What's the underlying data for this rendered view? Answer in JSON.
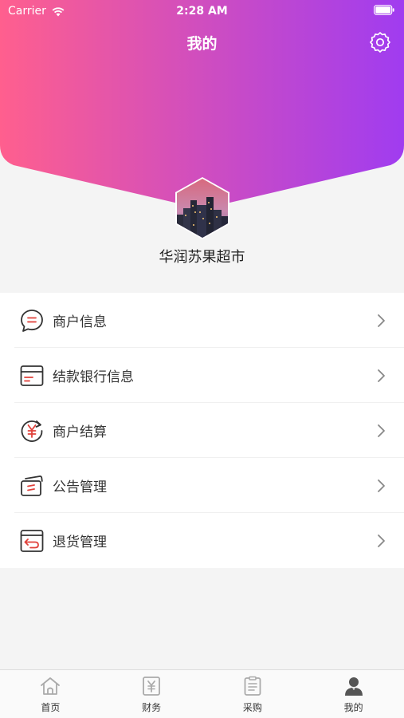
{
  "status_bar": {
    "carrier": "Carrier",
    "time": "2:28 AM"
  },
  "header": {
    "title": "我的",
    "settings_icon": "gear-icon"
  },
  "colors": {
    "gradient_start": "#ff5f8e",
    "gradient_end": "#a03cf0",
    "icon_red": "#e0403a",
    "icon_dark": "#333333"
  },
  "profile": {
    "store_name": "华润苏果超市"
  },
  "menu": {
    "items": [
      {
        "label": "商户信息",
        "icon": "chat-bubble-icon"
      },
      {
        "label": "结款银行信息",
        "icon": "bank-card-icon"
      },
      {
        "label": "商户结算",
        "icon": "yuan-refresh-icon"
      },
      {
        "label": "公告管理",
        "icon": "notice-card-icon"
      },
      {
        "label": "退货管理",
        "icon": "return-box-icon"
      }
    ]
  },
  "tabbar": {
    "tabs": [
      {
        "label": "首页",
        "icon": "home-icon",
        "active": false
      },
      {
        "label": "财务",
        "icon": "finance-icon",
        "active": false
      },
      {
        "label": "采购",
        "icon": "purchase-icon",
        "active": false
      },
      {
        "label": "我的",
        "icon": "user-icon",
        "active": true
      }
    ]
  }
}
